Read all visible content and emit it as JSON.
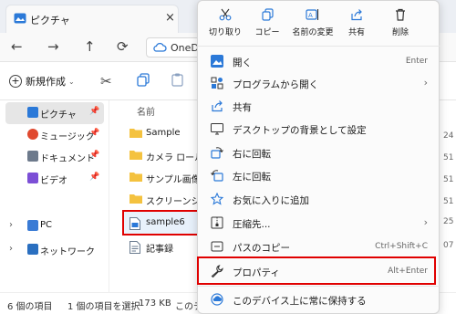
{
  "window": {
    "tab_title": "ピクチャ",
    "tab_close": "×",
    "address_text": "OneD",
    "new_button": "新規作成",
    "new_chevron": "⌄"
  },
  "sidebar": {
    "items": [
      {
        "label": "ピクチャ",
        "color": "#2b79d8",
        "pin": "📌"
      },
      {
        "label": "ミュージック",
        "color": "#e0492f",
        "pin": "📌"
      },
      {
        "label": "ドキュメント",
        "color": "#6d7a8c",
        "pin": "📌"
      },
      {
        "label": "ビデオ",
        "color": "#7c4fd6",
        "pin": "📌"
      },
      {
        "label": "PC",
        "color": "#3a7bd5"
      },
      {
        "label": "ネットワーク",
        "color": "#2a6fc0"
      }
    ]
  },
  "filelist": {
    "column_name": "名前",
    "files": [
      {
        "name": "Sample",
        "type": "folder"
      },
      {
        "name": "カメラ ロール",
        "type": "folder"
      },
      {
        "name": "サンプル画像",
        "type": "folder"
      },
      {
        "name": "スクリーンショット",
        "type": "folder"
      },
      {
        "name": "sample6",
        "type": "file"
      },
      {
        "name": "記事録",
        "type": "file"
      }
    ],
    "peek_values": [
      "24",
      "51",
      "51",
      "51",
      "25",
      "07"
    ]
  },
  "status": {
    "count": "6 個の項目",
    "selected": "1 個の項目を選択",
    "size": "173 KB",
    "extra": "このデ"
  },
  "context_menu": {
    "quick_actions": [
      {
        "label": "切り取り",
        "icon": "scissors-icon"
      },
      {
        "label": "コピー",
        "icon": "copy-icon"
      },
      {
        "label": "名前の変更",
        "icon": "rename-icon"
      },
      {
        "label": "共有",
        "icon": "share-icon"
      },
      {
        "label": "削除",
        "icon": "trash-icon"
      }
    ],
    "items": [
      {
        "label": "開く",
        "shortcut": "Enter"
      },
      {
        "label": "プログラムから開く",
        "chevron": "›"
      },
      {
        "label": "共有"
      },
      {
        "label": "デスクトップの背景として設定"
      },
      {
        "label": "右に回転"
      },
      {
        "label": "左に回転"
      },
      {
        "label": "お気に入りに追加"
      },
      {
        "label": "圧縮先...",
        "chevron": "›"
      },
      {
        "label": "パスのコピー",
        "shortcut": "Ctrl+Shift+C"
      },
      {
        "label": "プロパティ",
        "shortcut": "Alt+Enter"
      },
      {
        "label": "このデバイス上に常に保持する"
      }
    ]
  },
  "colors": {
    "accent": "#0067c0",
    "highlight_border": "#e00000",
    "folder": "#f4c23f"
  }
}
